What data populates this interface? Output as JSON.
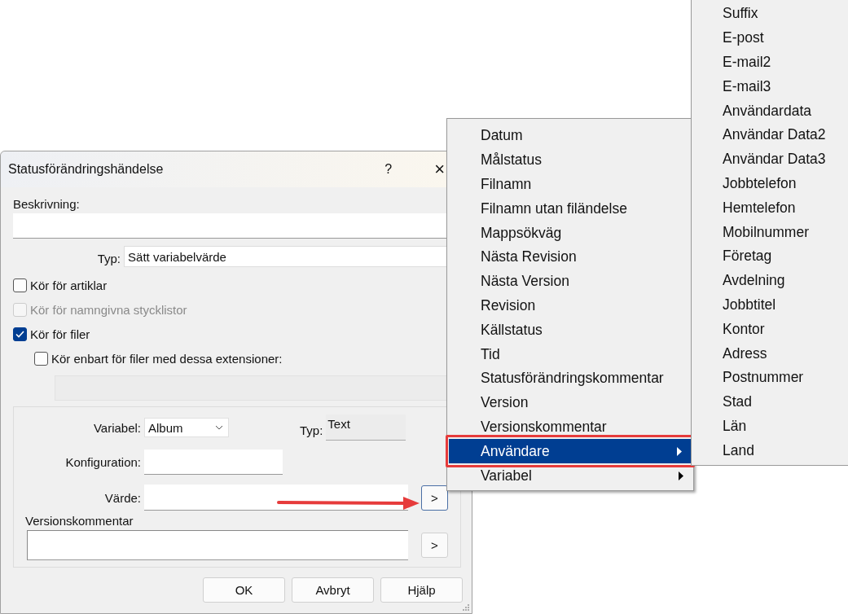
{
  "dialog": {
    "title": "Statusförändringshändelse",
    "help_button": "?",
    "close_button": "×",
    "description": {
      "label": "Beskrivning:"
    },
    "type": {
      "label": "Typ:",
      "value": "Sätt variabelvärde"
    },
    "checkboxes": [
      {
        "label": "Kör för artiklar",
        "checked": false,
        "disabled": false
      },
      {
        "label": "Kör för namngivna stycklistor",
        "checked": false,
        "disabled": true
      },
      {
        "label": "Kör för filer",
        "checked": true,
        "disabled": false,
        "children": [
          {
            "label": "Kör enbart för filer med dessa extensioner:",
            "checked": false,
            "disabled": false
          }
        ]
      }
    ],
    "variable": {
      "label": "Variabel:",
      "value": "Album",
      "type_label": "Typ:",
      "type_value": "Text"
    },
    "configuration": {
      "label": "Konfiguration:"
    },
    "value": {
      "label": "Värde:",
      "button": ">"
    },
    "version_comment": {
      "label": "Versionskommentar",
      "button": ">"
    },
    "buttons": [
      "OK",
      "Avbryt",
      "Hjälp"
    ]
  },
  "menu": {
    "items": [
      {
        "label": "Datum",
        "selected": false,
        "submenu": false
      },
      {
        "label": "Målstatus",
        "selected": false,
        "submenu": false
      },
      {
        "label": "Filnamn",
        "selected": false,
        "submenu": false
      },
      {
        "label": "Filnamn utan filändelse",
        "selected": false,
        "submenu": false
      },
      {
        "label": "Mappsökväg",
        "selected": false,
        "submenu": false
      },
      {
        "label": "Nästa Revision",
        "selected": false,
        "submenu": false
      },
      {
        "label": "Nästa Version",
        "selected": false,
        "submenu": false
      },
      {
        "label": "Revision",
        "selected": false,
        "submenu": false
      },
      {
        "label": "Källstatus",
        "selected": false,
        "submenu": false
      },
      {
        "label": "Tid",
        "selected": false,
        "submenu": false
      },
      {
        "label": "Statusförändringskommentar",
        "selected": false,
        "submenu": false
      },
      {
        "label": "Version",
        "selected": false,
        "submenu": false
      },
      {
        "label": "Versionskommentar",
        "selected": false,
        "submenu": false
      },
      {
        "label": "Användare",
        "selected": true,
        "submenu": true
      },
      {
        "label": "Variabel",
        "selected": false,
        "submenu": true
      }
    ]
  },
  "submenu": {
    "items": [
      "Suffix",
      "E-post",
      "E-mail2",
      "E-mail3",
      "Användardata",
      "Användar Data2",
      "Användar Data3",
      "Jobbtelefon",
      "Hemtelefon",
      "Mobilnummer",
      "Företag",
      "Avdelning",
      "Jobbtitel",
      "Kontor",
      "Adress",
      "Postnummer",
      "Stad",
      "Län",
      "Land"
    ]
  }
}
